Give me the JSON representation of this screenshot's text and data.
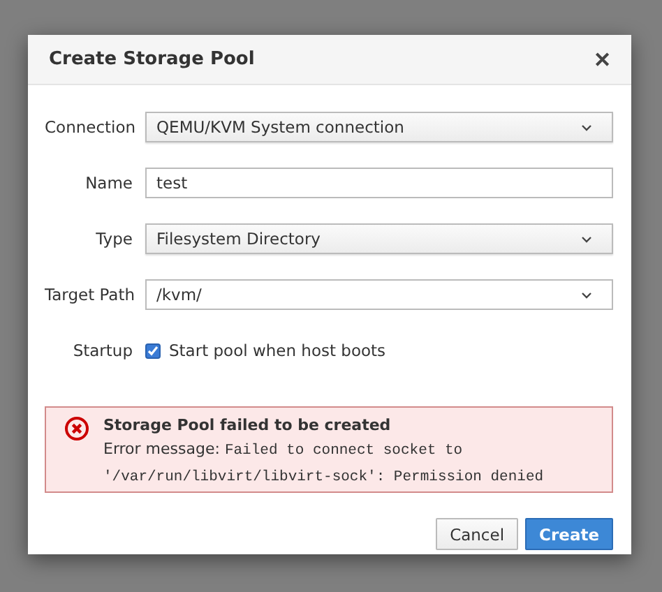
{
  "dialog": {
    "title": "Create Storage Pool",
    "close": "✕"
  },
  "fields": [
    {
      "kind": "select",
      "label": "Connection",
      "value": "QEMU/KVM System connection"
    },
    {
      "kind": "text",
      "label": "Name",
      "value": "test"
    },
    {
      "kind": "select",
      "label": "Type",
      "value": "Filesystem Directory"
    },
    {
      "kind": "combo",
      "label": "Target Path",
      "value": "/kvm/"
    },
    {
      "kind": "checkbox",
      "label": "Startup",
      "value": "Start pool when host boots",
      "checked": true
    }
  ],
  "alert": {
    "title": "Storage Pool failed to be created",
    "prefix": "Error message: ",
    "detail": "Failed to connect socket to '/var/run/libvirt/libvirt-sock': Permission denied"
  },
  "buttons": [
    {
      "label": "Cancel",
      "kind": "default"
    },
    {
      "label": "Create",
      "kind": "primary"
    }
  ]
}
